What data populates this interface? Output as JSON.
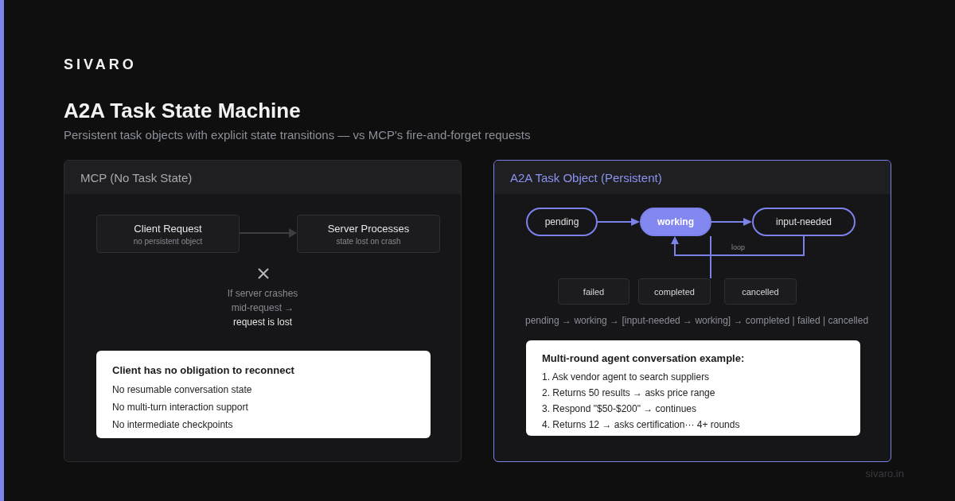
{
  "brand": "SIVARO",
  "title": "A2A Task State Machine",
  "subtitle": "Persistent task objects with explicit state transitions — vs MCP's fire-and-forget requests",
  "left_panel": {
    "title": "MCP (No Task State)",
    "nodes": [
      {
        "label": "Client Request",
        "note": "no persistent object"
      },
      {
        "label": "Server Processes",
        "note": "state lost on crash"
      }
    ],
    "failure_lines": [
      "If server crashes",
      "mid-request →"
    ],
    "failure_result": "request is lost",
    "card": {
      "title": "Client has no obligation to reconnect",
      "items": [
        "No resumable conversation state",
        "No multi-turn interaction support",
        "No intermediate checkpoints"
      ]
    }
  },
  "right_panel": {
    "title": "A2A Task Object (Persistent)",
    "states": [
      {
        "label": "pending",
        "selected": false
      },
      {
        "label": "working",
        "selected": true
      },
      {
        "label": "input-needed",
        "selected": false
      }
    ],
    "terminal_states": [
      "failed",
      "completed",
      "cancelled"
    ],
    "loop_label": "loop",
    "sequence": "pending → working → [input-needed → working] → completed | failed | cancelled",
    "card": {
      "title": "Multi-round agent conversation example:",
      "items": [
        "1. Ask vendor agent to search suppliers",
        "2. Returns 50 results → asks price range",
        "3. Respond \"$50-$200\" → continues",
        "4. Returns 12 → asks certification··· 4+ rounds"
      ]
    }
  },
  "footer": "sivaro.in"
}
